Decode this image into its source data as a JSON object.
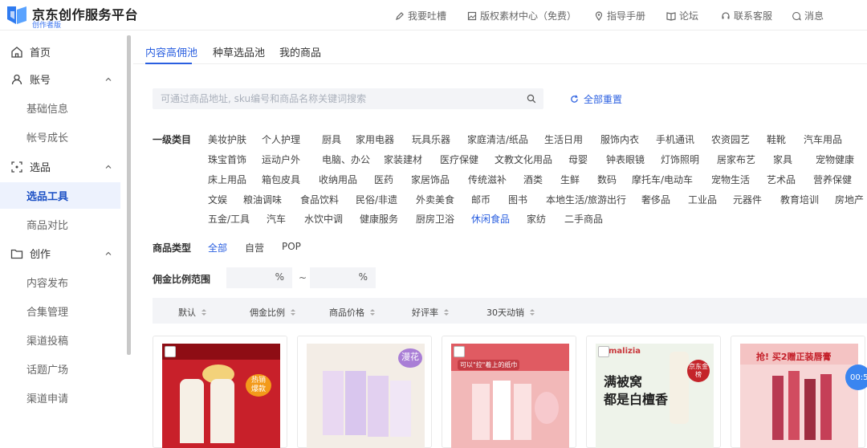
{
  "brand": {
    "title": "京东创作服务平台",
    "subtitle": "创作者版"
  },
  "topnav": [
    {
      "label": "我要吐槽",
      "icon": "pen-icon"
    },
    {
      "label": "版权素材中心（免费）",
      "icon": "image-icon"
    },
    {
      "label": "指导手册",
      "icon": "location-pin-icon"
    },
    {
      "label": "论坛",
      "icon": "book-icon"
    },
    {
      "label": "联系客服",
      "icon": "headset-icon"
    },
    {
      "label": "消息",
      "icon": "chat-bubble-icon"
    }
  ],
  "sidebar": {
    "home": "首页",
    "account": "账号",
    "account_items": [
      "基础信息",
      "帐号成长"
    ],
    "selection": "选品",
    "selection_items": [
      "选品工具",
      "商品对比"
    ],
    "create": "创作",
    "create_items": [
      "内容发布",
      "合集管理",
      "渠道投稿",
      "话题广场",
      "渠道申请"
    ]
  },
  "tabs": [
    "内容高佣池",
    "种草选品池",
    "我的商品"
  ],
  "search": {
    "placeholder": "可通过商品地址, sku编号和商品名称关键词搜索",
    "value": ""
  },
  "reset_label": "全部重置",
  "category_label": "一级类目",
  "categories": [
    [
      "美妆护肤",
      "个人护理",
      "厨具",
      "家用电器",
      "玩具乐器",
      "家庭清洁/纸品",
      "生活日用",
      "服饰内衣",
      "手机通讯",
      "农资园艺",
      "鞋靴",
      "汽车用品"
    ],
    [
      "珠宝首饰",
      "运动户外",
      "电脑、办公",
      "家装建材",
      "医疗保健",
      "文教文化用品",
      "母婴",
      "钟表眼镜",
      "灯饰照明",
      "居家布艺",
      "家具",
      "宠物健康"
    ],
    [
      "床上用品",
      "箱包皮具",
      "收纳用品",
      "医药",
      "家居饰品",
      "传统滋补",
      "酒类",
      "生鲜",
      "数码",
      "摩托车/电动车",
      "宠物生活",
      "艺术品",
      "营养保健"
    ],
    [
      "文娱",
      "粮油调味",
      "食品饮料",
      "民俗/非遗",
      "外卖美食",
      "邮币",
      "图书",
      "本地生活/旅游出行",
      "奢侈品",
      "工业品",
      "元器件",
      "教育培训",
      "房地产"
    ],
    [
      "五金/工具",
      "汽车",
      "水饮中调",
      "健康服务",
      "厨房卫浴",
      "休闲食品",
      "家纺",
      "二手商品"
    ]
  ],
  "product_type": {
    "label": "商品类型",
    "options": [
      "全部",
      "自营",
      "POP"
    ],
    "selected": "全部"
  },
  "commission": {
    "label": "佣金比例范围",
    "unit": "%",
    "separator": "~"
  },
  "sort_columns": [
    "默认",
    "佣金比例",
    "商品价格",
    "好评率",
    "30天动销"
  ],
  "cards": [
    {
      "badge": "热销爆款",
      "tag": ""
    },
    {
      "badge": "",
      "tag": "漫花"
    },
    {
      "badge": "可以\"拉\"着上的纸巾",
      "tag": ""
    },
    {
      "badge": "",
      "tag": "",
      "brand": "malizia",
      "line1": "满被窝",
      "line2": "都是白檀香",
      "seal": "京东金榜"
    },
    {
      "badge": "",
      "tag": "",
      "line1": "抢! 买2赠正装唇膏"
    }
  ],
  "float_badge": "00:5",
  "colors": {
    "accent": "#2a5fe0",
    "active_bg": "#edf2fd"
  }
}
